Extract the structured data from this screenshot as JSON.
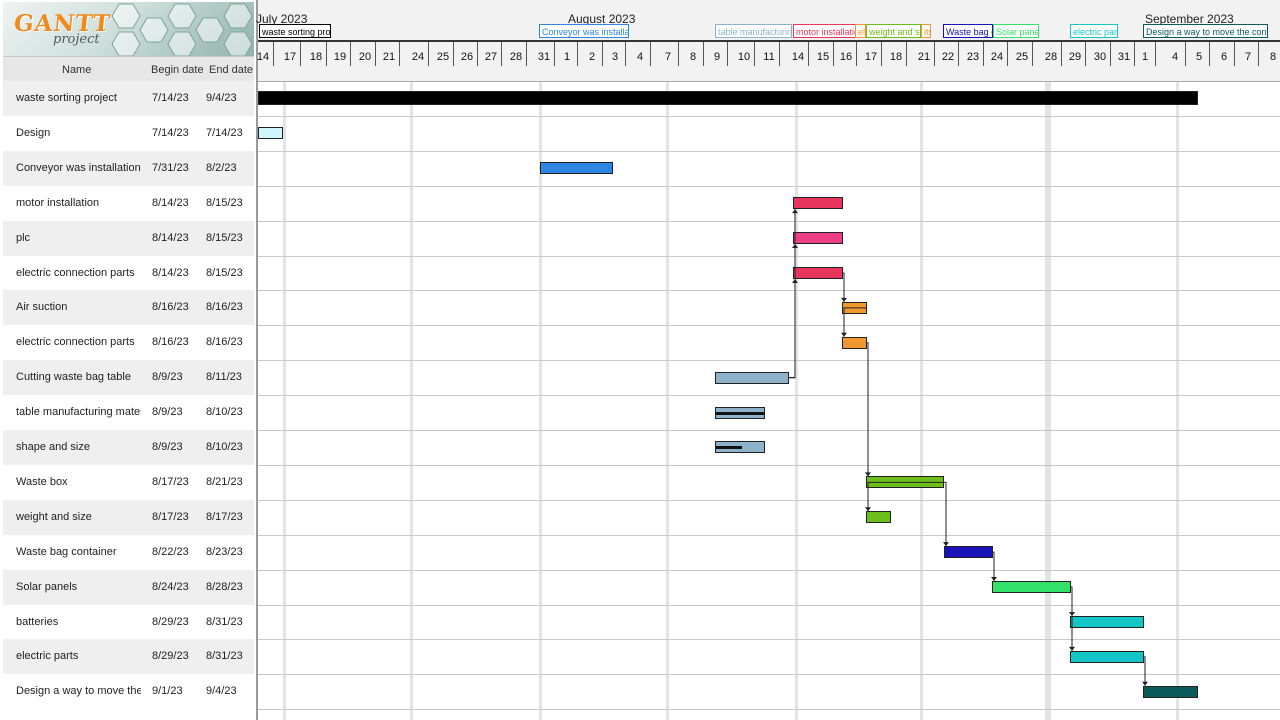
{
  "app": {
    "logo_text": "GANTT",
    "logo_sub": "project"
  },
  "columns": {
    "name": "Name",
    "begin": "Begin date",
    "end": "End date"
  },
  "months": [
    {
      "label": "July 2023"
    },
    {
      "label": "August 2023"
    },
    {
      "label": "September 2023"
    }
  ],
  "days": [
    "14",
    "17",
    "18",
    "19",
    "20",
    "21",
    "24",
    "25",
    "26",
    "27",
    "28",
    "31",
    "1",
    "2",
    "3",
    "4",
    "7",
    "8",
    "9",
    "10",
    "11",
    "14",
    "15",
    "16",
    "17",
    "18",
    "21",
    "22",
    "23",
    "24",
    "25",
    "28",
    "29",
    "30",
    "31",
    "1",
    "4",
    "5",
    "6",
    "7",
    "8"
  ],
  "flags": [
    {
      "label": "waste sorting project",
      "color": "#000000"
    },
    {
      "label": "Conveyor was installation",
      "color": "#2f86e0"
    },
    {
      "label": "table manufacturing materials",
      "color": "#8eb1cc"
    },
    {
      "label": "motor installation",
      "color": "#e8355e"
    },
    {
      "label": "electric",
      "color": "#f0982e"
    },
    {
      "label": "weight and size",
      "color": "#6cbf1a"
    },
    {
      "label": "its",
      "color": "#f0982e"
    },
    {
      "label": "Waste bag container",
      "color": "#1a12b8"
    },
    {
      "label": "Solar panels",
      "color": "#33e06a"
    },
    {
      "label": "electric parts",
      "color": "#14c6c6"
    },
    {
      "label": "Design a way to move the container",
      "color": "#0c5b5b"
    }
  ],
  "tasks": [
    {
      "name": "waste sorting project",
      "begin": "7/14/23",
      "end": "9/4/23",
      "color": "#000000",
      "progress": 0,
      "summary": true
    },
    {
      "name": "Design",
      "begin": "7/14/23",
      "end": "7/14/23",
      "color": "#cff7fb",
      "progress": 0
    },
    {
      "name": "Conveyor was installation",
      "begin": "7/31/23",
      "end": "8/2/23",
      "color": "#2f86e0",
      "progress": 0
    },
    {
      "name": "motor installation",
      "begin": "8/14/23",
      "end": "8/15/23",
      "color": "#e8355e",
      "progress": 0
    },
    {
      "name": "plc",
      "begin": "8/14/23",
      "end": "8/15/23",
      "color": "#ec3f86",
      "progress": 0
    },
    {
      "name": "electric connection parts",
      "begin": "8/14/23",
      "end": "8/15/23",
      "color": "#e8355e",
      "progress": 0
    },
    {
      "name": "Air suction",
      "begin": "8/16/23",
      "end": "8/16/23",
      "color": "#f0982e",
      "progress": 0
    },
    {
      "name": "electric connection parts",
      "begin": "8/16/23",
      "end": "8/16/23",
      "color": "#f0982e",
      "progress": 0
    },
    {
      "name": "Cutting waste bag table",
      "begin": "8/9/23",
      "end": "8/11/23",
      "color": "#8eb1cc",
      "progress": 0
    },
    {
      "name": "table manufacturing materials",
      "begin": "8/9/23",
      "end": "8/10/23",
      "color": "#8eb1cc",
      "progress": 100
    },
    {
      "name": "shape and size",
      "begin": "8/9/23",
      "end": "8/10/23",
      "color": "#8eb1cc",
      "progress": 55
    },
    {
      "name": "Waste box",
      "begin": "8/17/23",
      "end": "8/21/23",
      "color": "#6cbf1a",
      "progress": 0
    },
    {
      "name": "weight and size",
      "begin": "8/17/23",
      "end": "8/17/23",
      "color": "#6cbf1a",
      "progress": 0
    },
    {
      "name": "Waste bag container",
      "begin": "8/22/23",
      "end": "8/23/23",
      "color": "#1a12b8",
      "progress": 0
    },
    {
      "name": "Solar panels",
      "begin": "8/24/23",
      "end": "8/28/23",
      "color": "#33e06a",
      "progress": 0
    },
    {
      "name": "batteries",
      "begin": "8/29/23",
      "end": "8/31/23",
      "color": "#14c6c6",
      "progress": 0
    },
    {
      "name": "electric parts",
      "begin": "8/29/23",
      "end": "8/31/23",
      "color": "#14c6c6",
      "progress": 0
    },
    {
      "name": "Design a way to move the co...",
      "begin": "9/1/23",
      "end": "9/4/23",
      "color": "#0c5b5b",
      "progress": 0
    }
  ]
}
